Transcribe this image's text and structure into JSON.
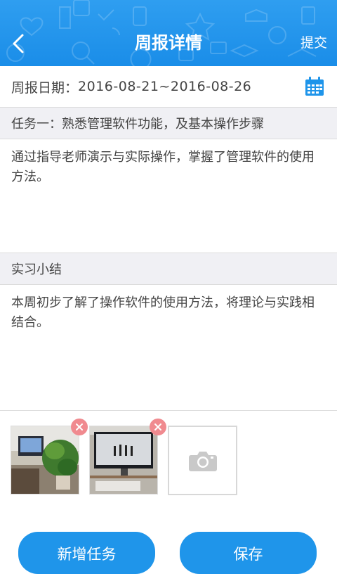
{
  "header": {
    "title": "周报详情",
    "submit_label": "提交"
  },
  "report_date": {
    "label": "周报日期：",
    "value": "2016-08-21~2016-08-26"
  },
  "task": {
    "title": "任务一：熟悉管理软件功能，及基本操作步骤",
    "content": "通过指导老师演示与实际操作，掌握了管理软件的使用方法。"
  },
  "summary": {
    "title": "实习小结",
    "content": "本周初步了解了操作软件的使用方法，将理论与实践相结合。"
  },
  "photos": [
    {
      "name": "office-desk-plant-photo"
    },
    {
      "name": "computer-monitor-photo"
    }
  ],
  "buttons": {
    "add_task": "新增任务",
    "save": "保存"
  },
  "colors": {
    "primary": "#1f95ea",
    "header": "#2f9ef0",
    "delete": "#f08a8f",
    "section_bg": "#f0f0f4"
  }
}
